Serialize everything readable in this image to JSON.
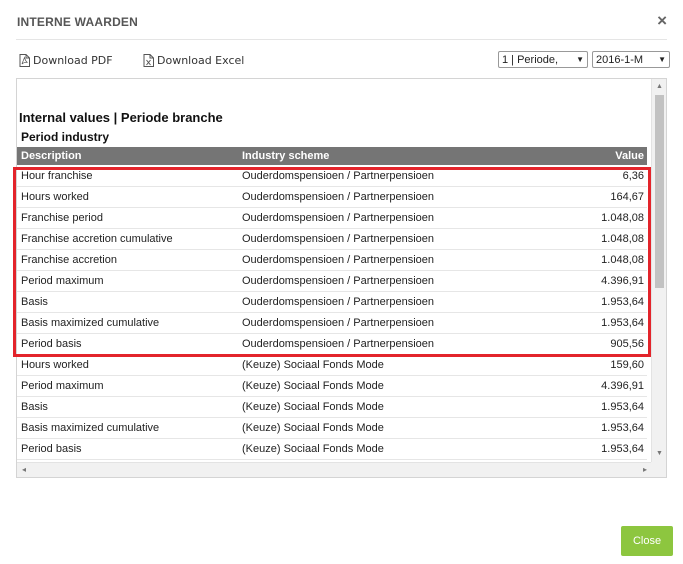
{
  "modal": {
    "title": "INTERNE WAARDEN",
    "close_glyph": "×"
  },
  "toolbar": {
    "download_pdf": "Download PDF",
    "download_excel": "Download Excel",
    "period_select": "1 | Periode,",
    "date_select": "2016-1-M"
  },
  "report": {
    "title": "Internal values | Periode branche",
    "subtitle": "Period industry",
    "columns": [
      "Description",
      "Industry scheme",
      "Value"
    ],
    "rows": [
      [
        "Hour franchise",
        "Ouderdomspensioen / Partnerpensioen",
        "6,36"
      ],
      [
        "Hours worked",
        "Ouderdomspensioen / Partnerpensioen",
        "164,67"
      ],
      [
        "Franchise period",
        "Ouderdomspensioen / Partnerpensioen",
        "1.048,08"
      ],
      [
        "Franchise accretion cumulative",
        "Ouderdomspensioen / Partnerpensioen",
        "1.048,08"
      ],
      [
        "Franchise accretion",
        "Ouderdomspensioen / Partnerpensioen",
        "1.048,08"
      ],
      [
        "Period maximum",
        "Ouderdomspensioen / Partnerpensioen",
        "4.396,91"
      ],
      [
        "Basis",
        "Ouderdomspensioen / Partnerpensioen",
        "1.953,64"
      ],
      [
        "Basis maximized cumulative",
        "Ouderdomspensioen / Partnerpensioen",
        "1.953,64"
      ],
      [
        "Period basis",
        "Ouderdomspensioen / Partnerpensioen",
        "905,56"
      ],
      [
        "Hours worked",
        "(Keuze) Sociaal Fonds Mode",
        "159,60"
      ],
      [
        "Period maximum",
        "(Keuze) Sociaal Fonds Mode",
        "4.396,91"
      ],
      [
        "Basis",
        "(Keuze) Sociaal Fonds Mode",
        "1.953,64"
      ],
      [
        "Basis maximized cumulative",
        "(Keuze) Sociaal Fonds Mode",
        "1.953,64"
      ],
      [
        "Period basis",
        "(Keuze) Sociaal Fonds Mode",
        "1.953,64"
      ]
    ]
  },
  "footer": {
    "close_label": "Close"
  },
  "colors": {
    "header_bg": "#757575",
    "highlight": "#e3242b",
    "close_button": "#8dc63f"
  },
  "icons": [
    "pdf-file-icon",
    "excel-file-icon",
    "close-icon",
    "dropdown-caret-icon"
  ]
}
